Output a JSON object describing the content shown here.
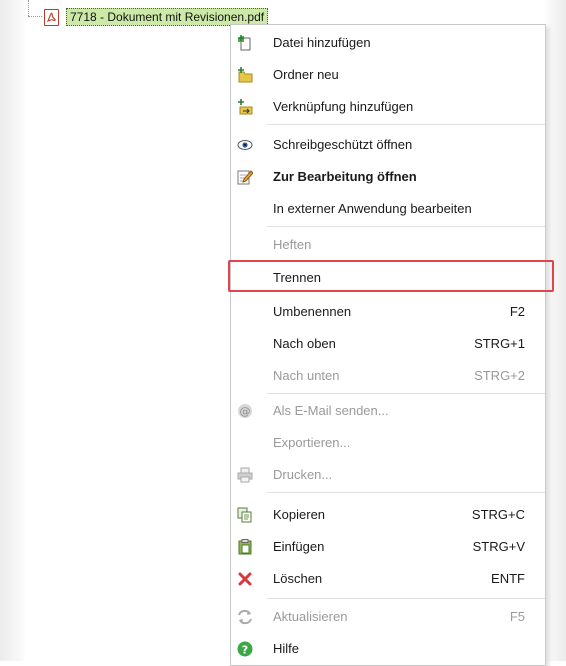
{
  "tree": {
    "node_label": "7718 - Dokument mit Revisionen.pdf",
    "node_icon": "pdf-icon"
  },
  "menu": {
    "items": [
      {
        "label": "Datei hinzufügen",
        "shortcut": "",
        "icon": "add-file-icon",
        "disabled": false,
        "bold": false
      },
      {
        "label": "Ordner neu",
        "shortcut": "",
        "icon": "new-folder-icon",
        "disabled": false,
        "bold": false
      },
      {
        "label": "Verknüpfung hinzufügen",
        "shortcut": "",
        "icon": "add-link-icon",
        "disabled": false,
        "bold": false
      },
      {
        "label": "Schreibgeschützt öffnen",
        "shortcut": "",
        "icon": "eye-icon",
        "disabled": false,
        "bold": false
      },
      {
        "label": "Zur Bearbeitung öffnen",
        "shortcut": "",
        "icon": "edit-document-icon",
        "disabled": false,
        "bold": true
      },
      {
        "label": "In externer Anwendung bearbeiten",
        "shortcut": "",
        "icon": "",
        "disabled": false,
        "bold": false
      },
      {
        "label": "Heften",
        "shortcut": "",
        "icon": "",
        "disabled": true,
        "bold": false
      },
      {
        "label": "Trennen",
        "shortcut": "",
        "icon": "",
        "disabled": false,
        "bold": false,
        "highlighted": true
      },
      {
        "label": "Umbenennen",
        "shortcut": "F2",
        "icon": "",
        "disabled": false,
        "bold": false
      },
      {
        "label": "Nach oben",
        "shortcut": "STRG+1",
        "icon": "",
        "disabled": false,
        "bold": false
      },
      {
        "label": "Nach unten",
        "shortcut": "STRG+2",
        "icon": "",
        "disabled": true,
        "bold": false
      },
      {
        "label": "Als E-Mail senden...",
        "shortcut": "",
        "icon": "at-sign-icon",
        "disabled": true,
        "bold": false
      },
      {
        "label": "Exportieren...",
        "shortcut": "",
        "icon": "",
        "disabled": true,
        "bold": false
      },
      {
        "label": "Drucken...",
        "shortcut": "",
        "icon": "printer-icon",
        "disabled": true,
        "bold": false
      },
      {
        "label": "Kopieren",
        "shortcut": "STRG+C",
        "icon": "copy-icon",
        "disabled": false,
        "bold": false
      },
      {
        "label": "Einfügen",
        "shortcut": "STRG+V",
        "icon": "paste-icon",
        "disabled": false,
        "bold": false
      },
      {
        "label": "Löschen",
        "shortcut": "ENTF",
        "icon": "delete-icon",
        "disabled": false,
        "bold": false
      },
      {
        "label": "Aktualisieren",
        "shortcut": "F5",
        "icon": "refresh-icon",
        "disabled": true,
        "bold": false
      },
      {
        "label": "Hilfe",
        "shortcut": "",
        "icon": "help-icon",
        "disabled": false,
        "bold": false
      }
    ]
  },
  "colors": {
    "highlight_border": "#e0444d",
    "node_background": "#cde9a8",
    "delete_icon": "#d9363e",
    "help_icon": "#3aa845"
  }
}
